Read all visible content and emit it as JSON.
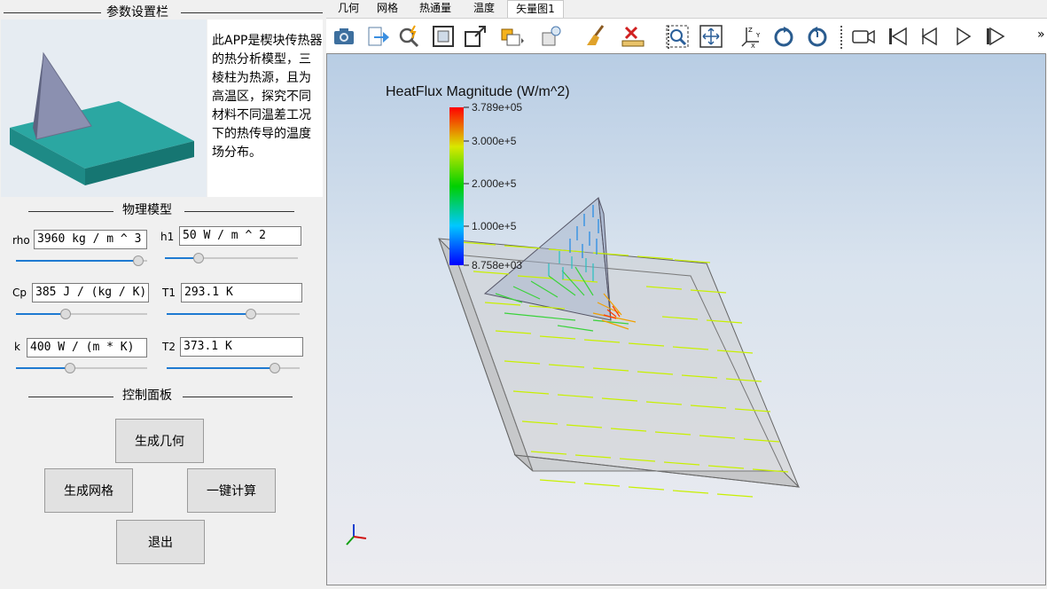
{
  "params_panel": {
    "title": "参数设置栏",
    "description": "此APP是楔块传热器的热分析模型，三棱柱为热源，且为高温区，探究不同材料不同温差工况下的热传导的温度场分布。",
    "physics_title": "物理模型",
    "fields": {
      "rho": {
        "label": "rho",
        "value": "3960 kg / m ^ 3",
        "slider": 0.93
      },
      "h1": {
        "label": "h1",
        "value": "50 W / m ^ 2",
        "slider": 0.25
      },
      "cp": {
        "label": "Cp",
        "value": "385 J / (kg / K)",
        "slider": 0.38
      },
      "t1": {
        "label": "T1",
        "value": "293.1 K",
        "slider": 0.63
      },
      "k": {
        "label": "k",
        "value": "400 W / (m * K)",
        "slider": 0.41
      },
      "t2": {
        "label": "T2",
        "value": "373.1 K",
        "slider": 0.81
      }
    },
    "control_title": "控制面板",
    "buttons": {
      "generate_geometry": "生成几何",
      "generate_mesh": "生成网格",
      "compute": "一键计算",
      "exit": "退出"
    }
  },
  "tabs": [
    {
      "label": "几何",
      "active": false
    },
    {
      "label": "网格",
      "active": false
    },
    {
      "label": "热通量",
      "active": false
    },
    {
      "label": "温度",
      "active": false
    },
    {
      "label": "矢量图1",
      "active": true
    }
  ],
  "toolbar": {
    "icons": [
      "camera-icon",
      "export-icon",
      "search-spark-icon",
      "zoom-box-icon",
      "zoom-extent-icon",
      "render-mode-icon",
      "light-icon",
      "clean-brush-icon",
      "measure-ruler-icon",
      "zoom-window-icon",
      "fit-view-icon",
      "axes-view-icon",
      "rotate-left-icon",
      "rotate-right-icon",
      "video-camera-icon",
      "first-frame-icon",
      "previous-frame-icon",
      "play-icon",
      "last-frame-icon"
    ],
    "overflow": "»"
  },
  "plot": {
    "legend_title": "HeatFlux Magnitude (W/m^2)",
    "colorbar_ticks": [
      "3.789e+05",
      "3.000e+5",
      "2.000e+5",
      "1.000e+5",
      "8.758e+03"
    ],
    "colors": {
      "high": "#ff0000",
      "mid": "#00d000",
      "low": "#0000ff"
    },
    "triad_labels": {
      "z": "",
      "y": "",
      "x": ""
    }
  }
}
